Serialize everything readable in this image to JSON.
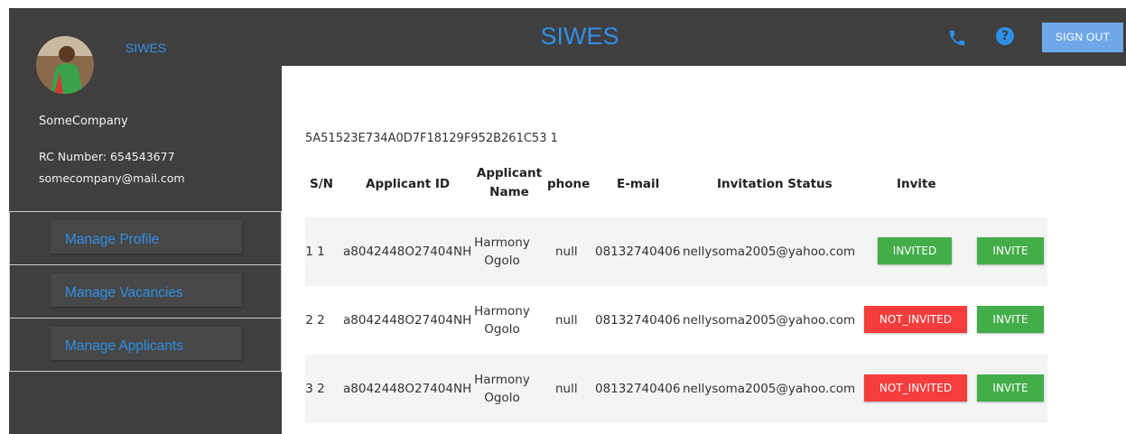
{
  "sidebar": {
    "brand": "SIWES",
    "company_name": "SomeCompany",
    "rc_number": "RC Number: 654543677",
    "email": "somecompany@mail.com",
    "nav": [
      "Manage Profile",
      "Manage Vacancies",
      "Manage Applicants"
    ]
  },
  "header": {
    "title": "SIWES",
    "phone_icon": "phone-icon",
    "help_icon": "help-icon",
    "help_glyph": "?",
    "signout_label": "SIGN OUT"
  },
  "main": {
    "code": "5A51523E734A0D7F18129F952B261C53 1",
    "columns": [
      "S/N",
      "Applicant ID",
      "Applicant Name",
      "phone",
      "E-mail",
      "Invitation Status",
      "Invite"
    ],
    "rows": [
      {
        "sn": "1 1",
        "applicant_id": "a8042448O27404NH",
        "name_first": "Harmony",
        "name_last": "Ogolo",
        "phone": "null",
        "phone_number": "08132740406",
        "email": "nellysoma2005@yahoo.com",
        "status": "INVITED",
        "action": "INVITE"
      },
      {
        "sn": "2 2",
        "applicant_id": "a8042448O27404NH",
        "name_first": "Harmony",
        "name_last": "Ogolo",
        "phone": "null",
        "phone_number": "08132740406",
        "email": "nellysoma2005@yahoo.com",
        "status": "NOT_INVITED",
        "action": "INVITE"
      },
      {
        "sn": "3 2",
        "applicant_id": "a8042448O27404NH",
        "name_first": "Harmony",
        "name_last": "Ogolo",
        "phone": "null",
        "phone_number": "08132740406",
        "email": "nellysoma2005@yahoo.com",
        "status": "NOT_INVITED",
        "action": "INVITE"
      }
    ]
  },
  "colors": {
    "accent": "#2f8fe8",
    "panel": "#3f3f3f",
    "invited": "#43ad4a",
    "not_invited": "#f53d3d"
  }
}
